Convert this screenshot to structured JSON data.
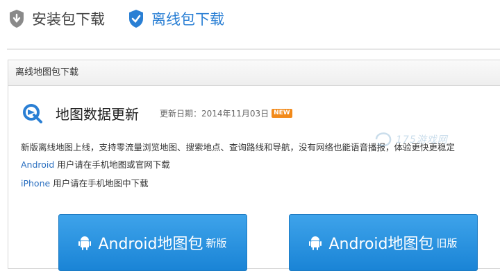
{
  "tabs": {
    "install_label": "安装包下载",
    "offline_label": "离线包下载"
  },
  "panel": {
    "header": "离线地图包下载",
    "title": "地图数据更新",
    "date_label": "更新日期：",
    "date_value": "2014年11月03日",
    "new_badge": "NEW",
    "description": "新版离线地图上线，支持零流量浏览地图、搜索地点、查询路线和导航，没有网络也能语音播报，体验更快更稳定",
    "android_note": {
      "platform": "Android",
      "text": " 用户请在手机地图或官网下载"
    },
    "iphone_note": {
      "platform": "iPhone",
      "text": " 用户请在手机地图中下载"
    }
  },
  "buttons": {
    "new": {
      "main": "Android地图包",
      "sub": "新版"
    },
    "old": {
      "main": "Android地图包",
      "sub": "旧版"
    }
  },
  "watermark": "175游戏网",
  "colors": {
    "accent_blue": "#2a7fd4",
    "button_blue": "#2b93e0",
    "badge_orange": "#f28a1a"
  },
  "icons": {
    "install_tab": "shield-down-icon",
    "offline_tab": "shield-check-icon",
    "map_logo": "map-logo-icon",
    "android": "android-icon"
  }
}
